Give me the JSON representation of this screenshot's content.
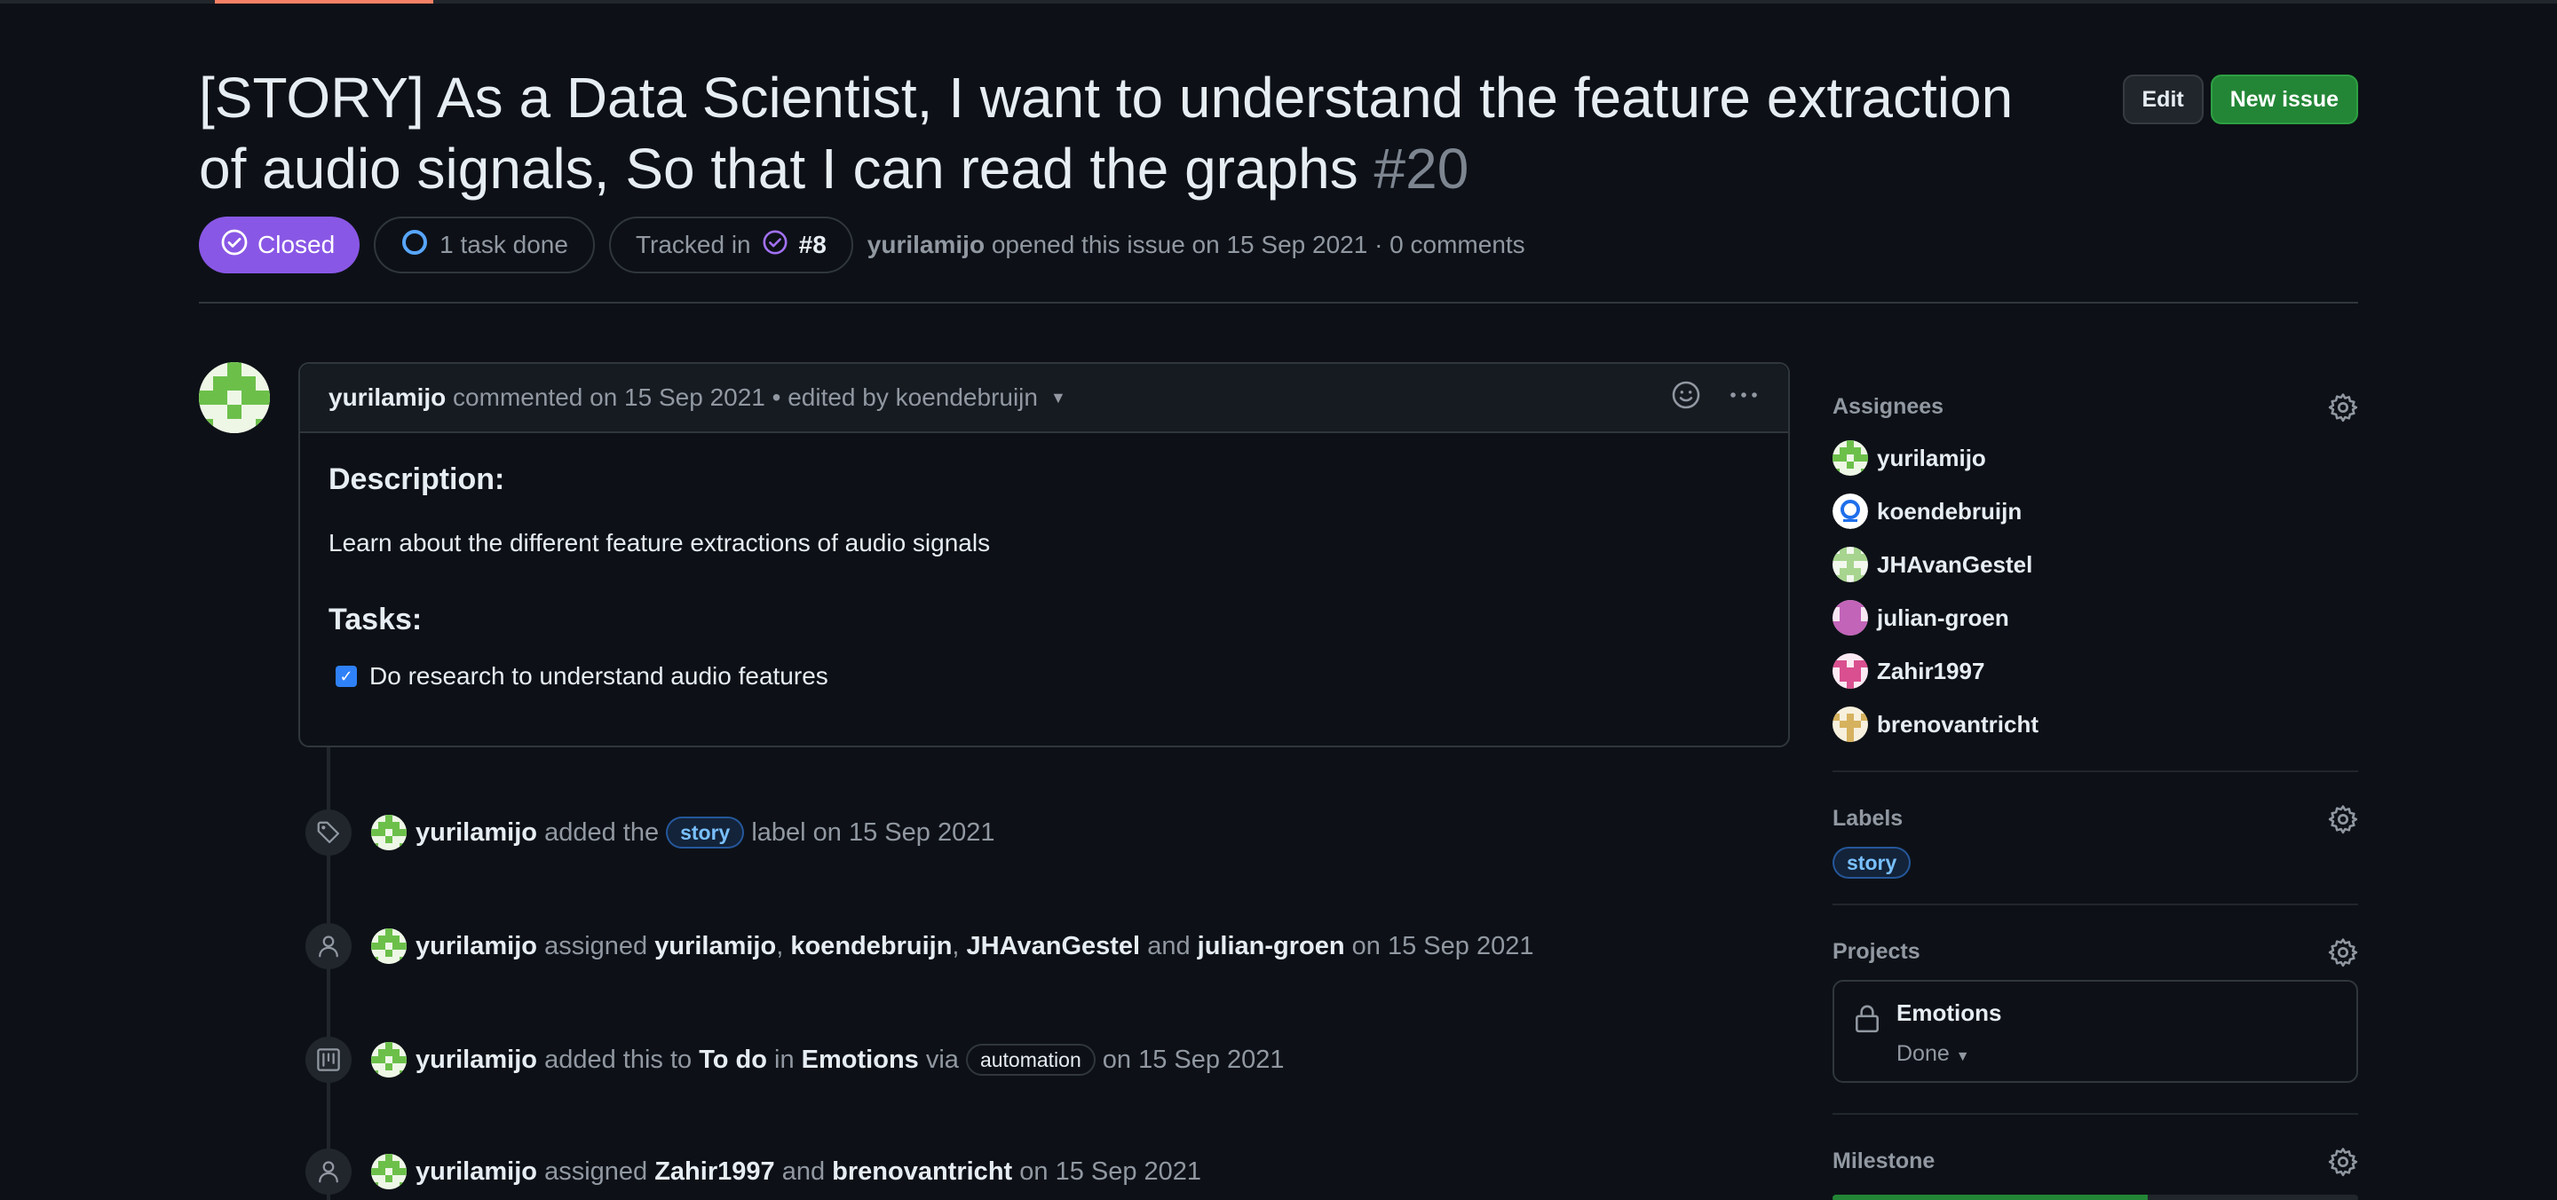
{
  "issue": {
    "title": "[STORY] As a Data Scientist, I want to understand the feature extraction of audio signals, So that I can read the graphs",
    "number": "#20",
    "status": "Closed",
    "tasks_done": "1 task done",
    "tracked_in_label": "Tracked in",
    "tracked_in_ref": "#8",
    "author": "yurilamijo",
    "opened_text": "opened this issue on 15 Sep 2021 · 0 comments"
  },
  "header": {
    "edit_label": "Edit",
    "new_issue_label": "New issue"
  },
  "comment": {
    "author": "yurilamijo",
    "meta": "commented on 15 Sep 2021 • edited by koendebruijn",
    "description_heading": "Description:",
    "description_text": "Learn about the different feature extractions of audio signals",
    "tasks_heading": "Tasks:",
    "task_1": "Do research to understand audio features",
    "task_1_checked": true
  },
  "timeline": {
    "e1": {
      "actor": "yurilamijo",
      "t1": "added the",
      "label": "story",
      "t2": "label on 15 Sep 2021"
    },
    "e2": {
      "actor": "yurilamijo",
      "t1": "assigned",
      "u1": "yurilamijo",
      "c1": ",",
      "u2": "koendebruijn",
      "c2": ",",
      "u3": "JHAvanGestel",
      "and": "and",
      "u4": "julian-groen",
      "t2": "on 15 Sep 2021"
    },
    "e3": {
      "actor": "yurilamijo",
      "t1": "added this to",
      "col": "To do",
      "in": "in",
      "proj": "Emotions",
      "via": "via",
      "label": "automation",
      "t2": "on 15 Sep 2021"
    },
    "e4": {
      "actor": "yurilamijo",
      "t1": "assigned",
      "u1": "Zahir1997",
      "and": "and",
      "u2": "brenovantricht",
      "t2": "on 15 Sep 2021"
    }
  },
  "sidebar": {
    "assignees_title": "Assignees",
    "assignees": [
      "yurilamijo",
      "koendebruijn",
      "JHAvanGestel",
      "julian-groen",
      "Zahir1997",
      "brenovantricht"
    ],
    "labels_title": "Labels",
    "label": "story",
    "projects_title": "Projects",
    "project_name": "Emotions",
    "project_status": "Done",
    "milestone_title": "Milestone",
    "milestone_progress": 0.6
  },
  "colors": {
    "closed": "#8957e5",
    "new_issue": "#238636",
    "label_blue": "#79c0ff",
    "accent_tab": "#f78166"
  },
  "icons": [
    "check-circle-icon",
    "issue-open-icon",
    "smiley-icon",
    "kebab-icon",
    "tag-icon",
    "person-icon",
    "project-icon",
    "gear-icon",
    "lock-icon",
    "triangle-down-icon"
  ]
}
